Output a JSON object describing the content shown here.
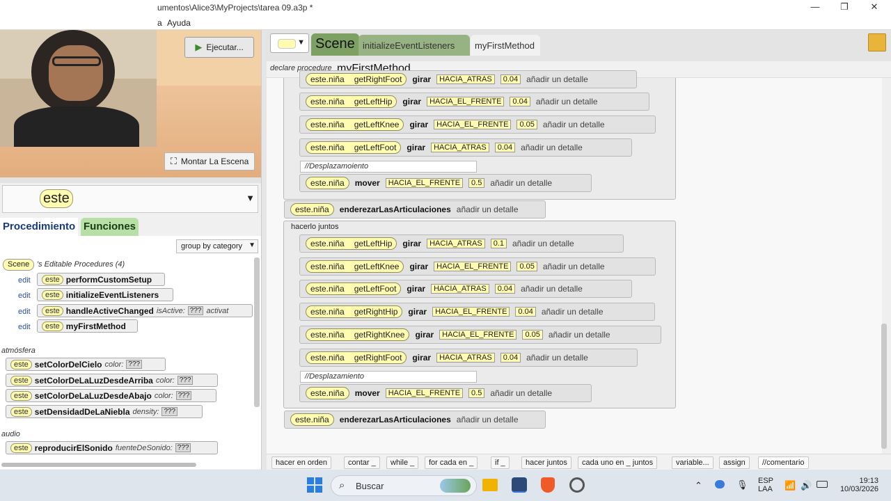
{
  "window": {
    "title": "umentos\\Alice3\\MyProjects\\tarea 09.a3p *"
  },
  "menu": [
    "a",
    "Ayuda"
  ],
  "scene_view": {
    "run_label": "Ejecutar...",
    "setup_label": "Montar La Escena"
  },
  "combo": {
    "value": "este"
  },
  "left_tabs": {
    "proc": "Procedimiento",
    "func": "Funciones"
  },
  "groupby": "group by category",
  "editable": {
    "owner": "Scene",
    "title": "'s Editable Procedures (4)",
    "edit": "edit",
    "this": "este",
    "items": [
      "performCustomSetup",
      "initializeEventListeners",
      "handleActiveChanged",
      "myFirstMethod"
    ],
    "param_isactive": "isActive:",
    "param_activat": "activat",
    "q": "???"
  },
  "categories": {
    "atmos": "atmósfera",
    "audio": "audio"
  },
  "atmos": [
    {
      "name": "setColorDelCielo",
      "param": "color:"
    },
    {
      "name": "setColorDeLaLuzDesdeArriba",
      "param": "color:"
    },
    {
      "name": "setColorDeLaLuzDesdeAbajo",
      "param": "color:"
    },
    {
      "name": "setDensidadDeLaNiebla",
      "param": "density:"
    }
  ],
  "audio": {
    "name": "reproducirElSonido",
    "param": "fuenteDeSonido:"
  },
  "editor": {
    "scene_tab": "Scene",
    "init_tab": "initializeEventListeners",
    "my_tab": "myFirstMethod",
    "declare_kw": "declare procedure",
    "declare_name": "myFirstMethod"
  },
  "code": {
    "obj": "este.niña",
    "girar": "girar",
    "mover": "mover",
    "det": "añadir un detalle",
    "enderezar": "enderezarLasArticulaciones",
    "hacerlo": "hacerlo juntos",
    "top": [
      {
        "joint": "getRightFoot",
        "dir": "HACIA_ATRAS",
        "amt": "0.04"
      },
      {
        "joint": "getLeftHip",
        "dir": "HACIA_EL_FRENTE",
        "amt": "0.04"
      },
      {
        "joint": "getLeftKnee",
        "dir": "HACIA_EL_FRENTE",
        "amt": "0.05"
      },
      {
        "joint": "getLeftFoot",
        "dir": "HACIA_ATRAS",
        "amt": "0.04"
      }
    ],
    "comment1": "//Desplazamoiento",
    "move1": {
      "dir": "HACIA_EL_FRENTE",
      "amt": "0.5"
    },
    "bottom": [
      {
        "joint": "getLeftHip",
        "dir": "HACIA_ATRAS",
        "amt": "0.1"
      },
      {
        "joint": "getLeftKnee",
        "dir": "HACIA_EL_FRENTE",
        "amt": "0.05"
      },
      {
        "joint": "getLeftFoot",
        "dir": "HACIA_ATRAS",
        "amt": "0.04"
      },
      {
        "joint": "getRightHip",
        "dir": "HACIA_EL_FRENTE",
        "amt": "0.04"
      },
      {
        "joint": "getRightKnee",
        "dir": "HACIA_EL_FRENTE",
        "amt": "0.05"
      },
      {
        "joint": "getRightFoot",
        "dir": "HACIA_ATRAS",
        "amt": "0.04"
      }
    ],
    "comment2": "//Desplazamiento",
    "move2": {
      "dir": "HACIA_EL_FRENTE",
      "amt": "0.5"
    }
  },
  "palette": [
    "hacer en orden",
    "contar _",
    "while _",
    "for cada en _",
    "if _",
    "hacer juntos",
    "cada uno en _ juntos",
    "variable...",
    "assign",
    "//comentario"
  ],
  "taskbar": {
    "search": "Buscar",
    "lang1": "ESP",
    "lang2": "LAA",
    "time": "19:13",
    "date": "10/03/2026"
  }
}
